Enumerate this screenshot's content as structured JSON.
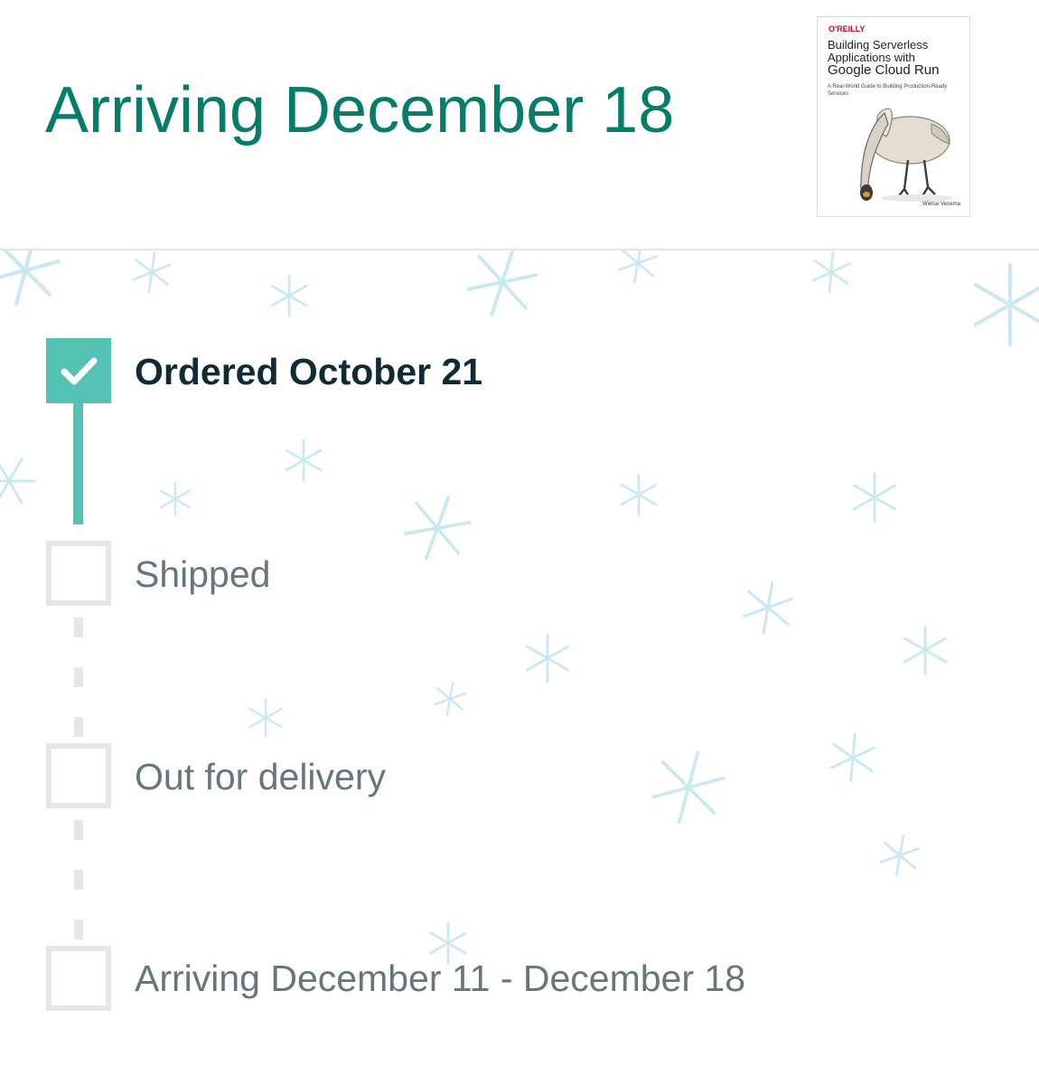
{
  "header": {
    "headline": "Arriving December 18"
  },
  "product": {
    "publisher": "O'REILLY",
    "title_line1": "Building Serverless",
    "title_line2": "Applications with",
    "title_line3": "Google Cloud Run",
    "subtitle": "A Real-World Guide to Building Production-Ready Services",
    "author": "Wietse Venema"
  },
  "tracker": {
    "steps": [
      {
        "label": "Ordered October 21",
        "status": "complete"
      },
      {
        "label": "Shipped",
        "status": "pending"
      },
      {
        "label": "Out for delivery",
        "status": "pending"
      },
      {
        "label": "Arriving December 11 - December 18",
        "status": "pending"
      }
    ]
  },
  "colors": {
    "headline": "#067d68",
    "progress_complete": "#55c3b3",
    "progress_pending": "#e6e6e6",
    "label_active": "#0f2b33",
    "label_pending": "#66777a",
    "snowflake": "#c9e8f0"
  },
  "icons": {
    "step_complete": "check-icon",
    "decoration": "snowflake-icon"
  }
}
